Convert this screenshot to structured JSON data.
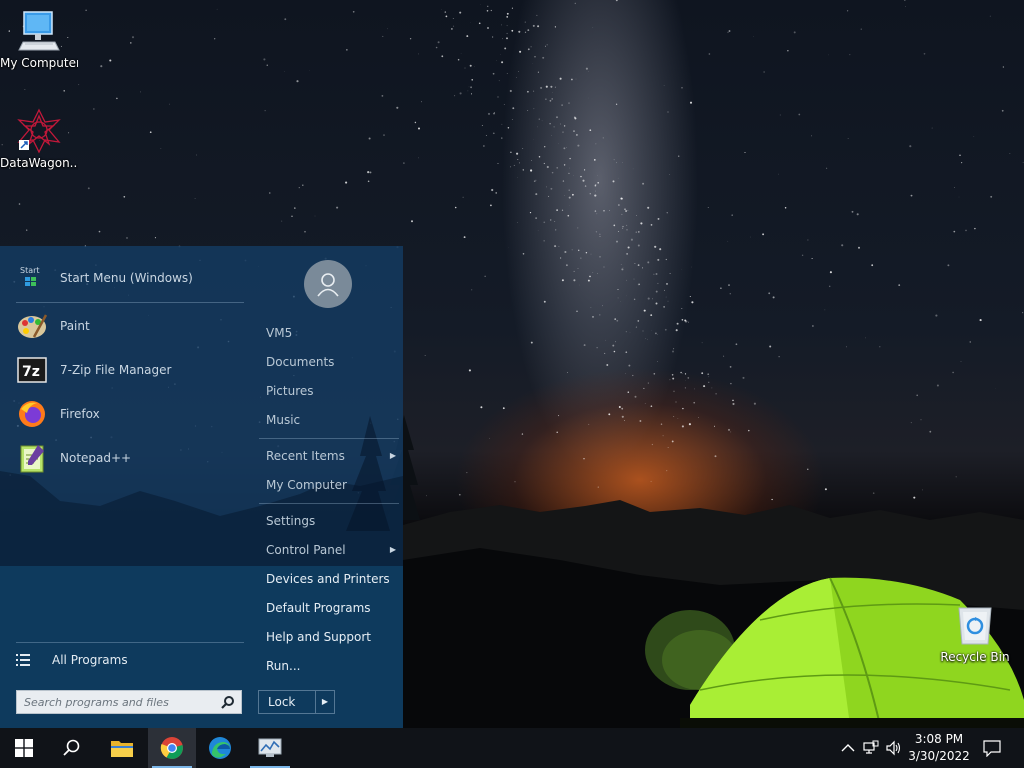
{
  "desktop": {
    "icons": [
      {
        "label": "My Computer",
        "icon": "my-computer-icon"
      },
      {
        "label": "DataWagon...",
        "icon": "datawagon-icon"
      },
      {
        "label": "Recycle Bin",
        "icon": "recycle-bin-icon"
      }
    ]
  },
  "start_menu": {
    "pinned": [
      {
        "label": "Start Menu (Windows)",
        "icon": "start-menu-app-icon"
      },
      {
        "label": "Paint",
        "icon": "paint-icon"
      },
      {
        "label": "7-Zip File Manager",
        "icon": "7zip-icon"
      },
      {
        "label": "Firefox",
        "icon": "firefox-icon"
      },
      {
        "label": "Notepad++",
        "icon": "notepadpp-icon"
      }
    ],
    "start_badge": "Start",
    "zip_badge": "7z",
    "all_programs": "All Programs",
    "search_placeholder": "Search programs and files",
    "user": "VM5",
    "links": [
      {
        "label": "VM5"
      },
      {
        "label": "Documents"
      },
      {
        "label": "Pictures"
      },
      {
        "label": "Music"
      },
      {
        "label": "Recent Items"
      },
      {
        "label": "My Computer"
      },
      {
        "label": "Settings"
      },
      {
        "label": "Control Panel"
      },
      {
        "label": "Devices and Printers"
      },
      {
        "label": "Default Programs"
      },
      {
        "label": "Help and Support"
      },
      {
        "label": "Run..."
      }
    ],
    "lock_label": "Lock"
  },
  "taskbar": {
    "apps": [
      {
        "name": "start",
        "icon": "windows-logo-icon"
      },
      {
        "name": "search",
        "icon": "search-icon"
      },
      {
        "name": "file-explorer",
        "icon": "folder-icon"
      },
      {
        "name": "chrome",
        "icon": "chrome-icon"
      },
      {
        "name": "edge",
        "icon": "edge-icon"
      },
      {
        "name": "task-manager",
        "icon": "monitor-chart-icon"
      }
    ],
    "clock_time": "3:08 PM",
    "clock_date": "3/30/2022"
  },
  "colors": {
    "menu_bg": "#143c64",
    "taskbar_bg": "#101318",
    "accent": "#7bb6e8",
    "tent_green": "#9be22a"
  }
}
